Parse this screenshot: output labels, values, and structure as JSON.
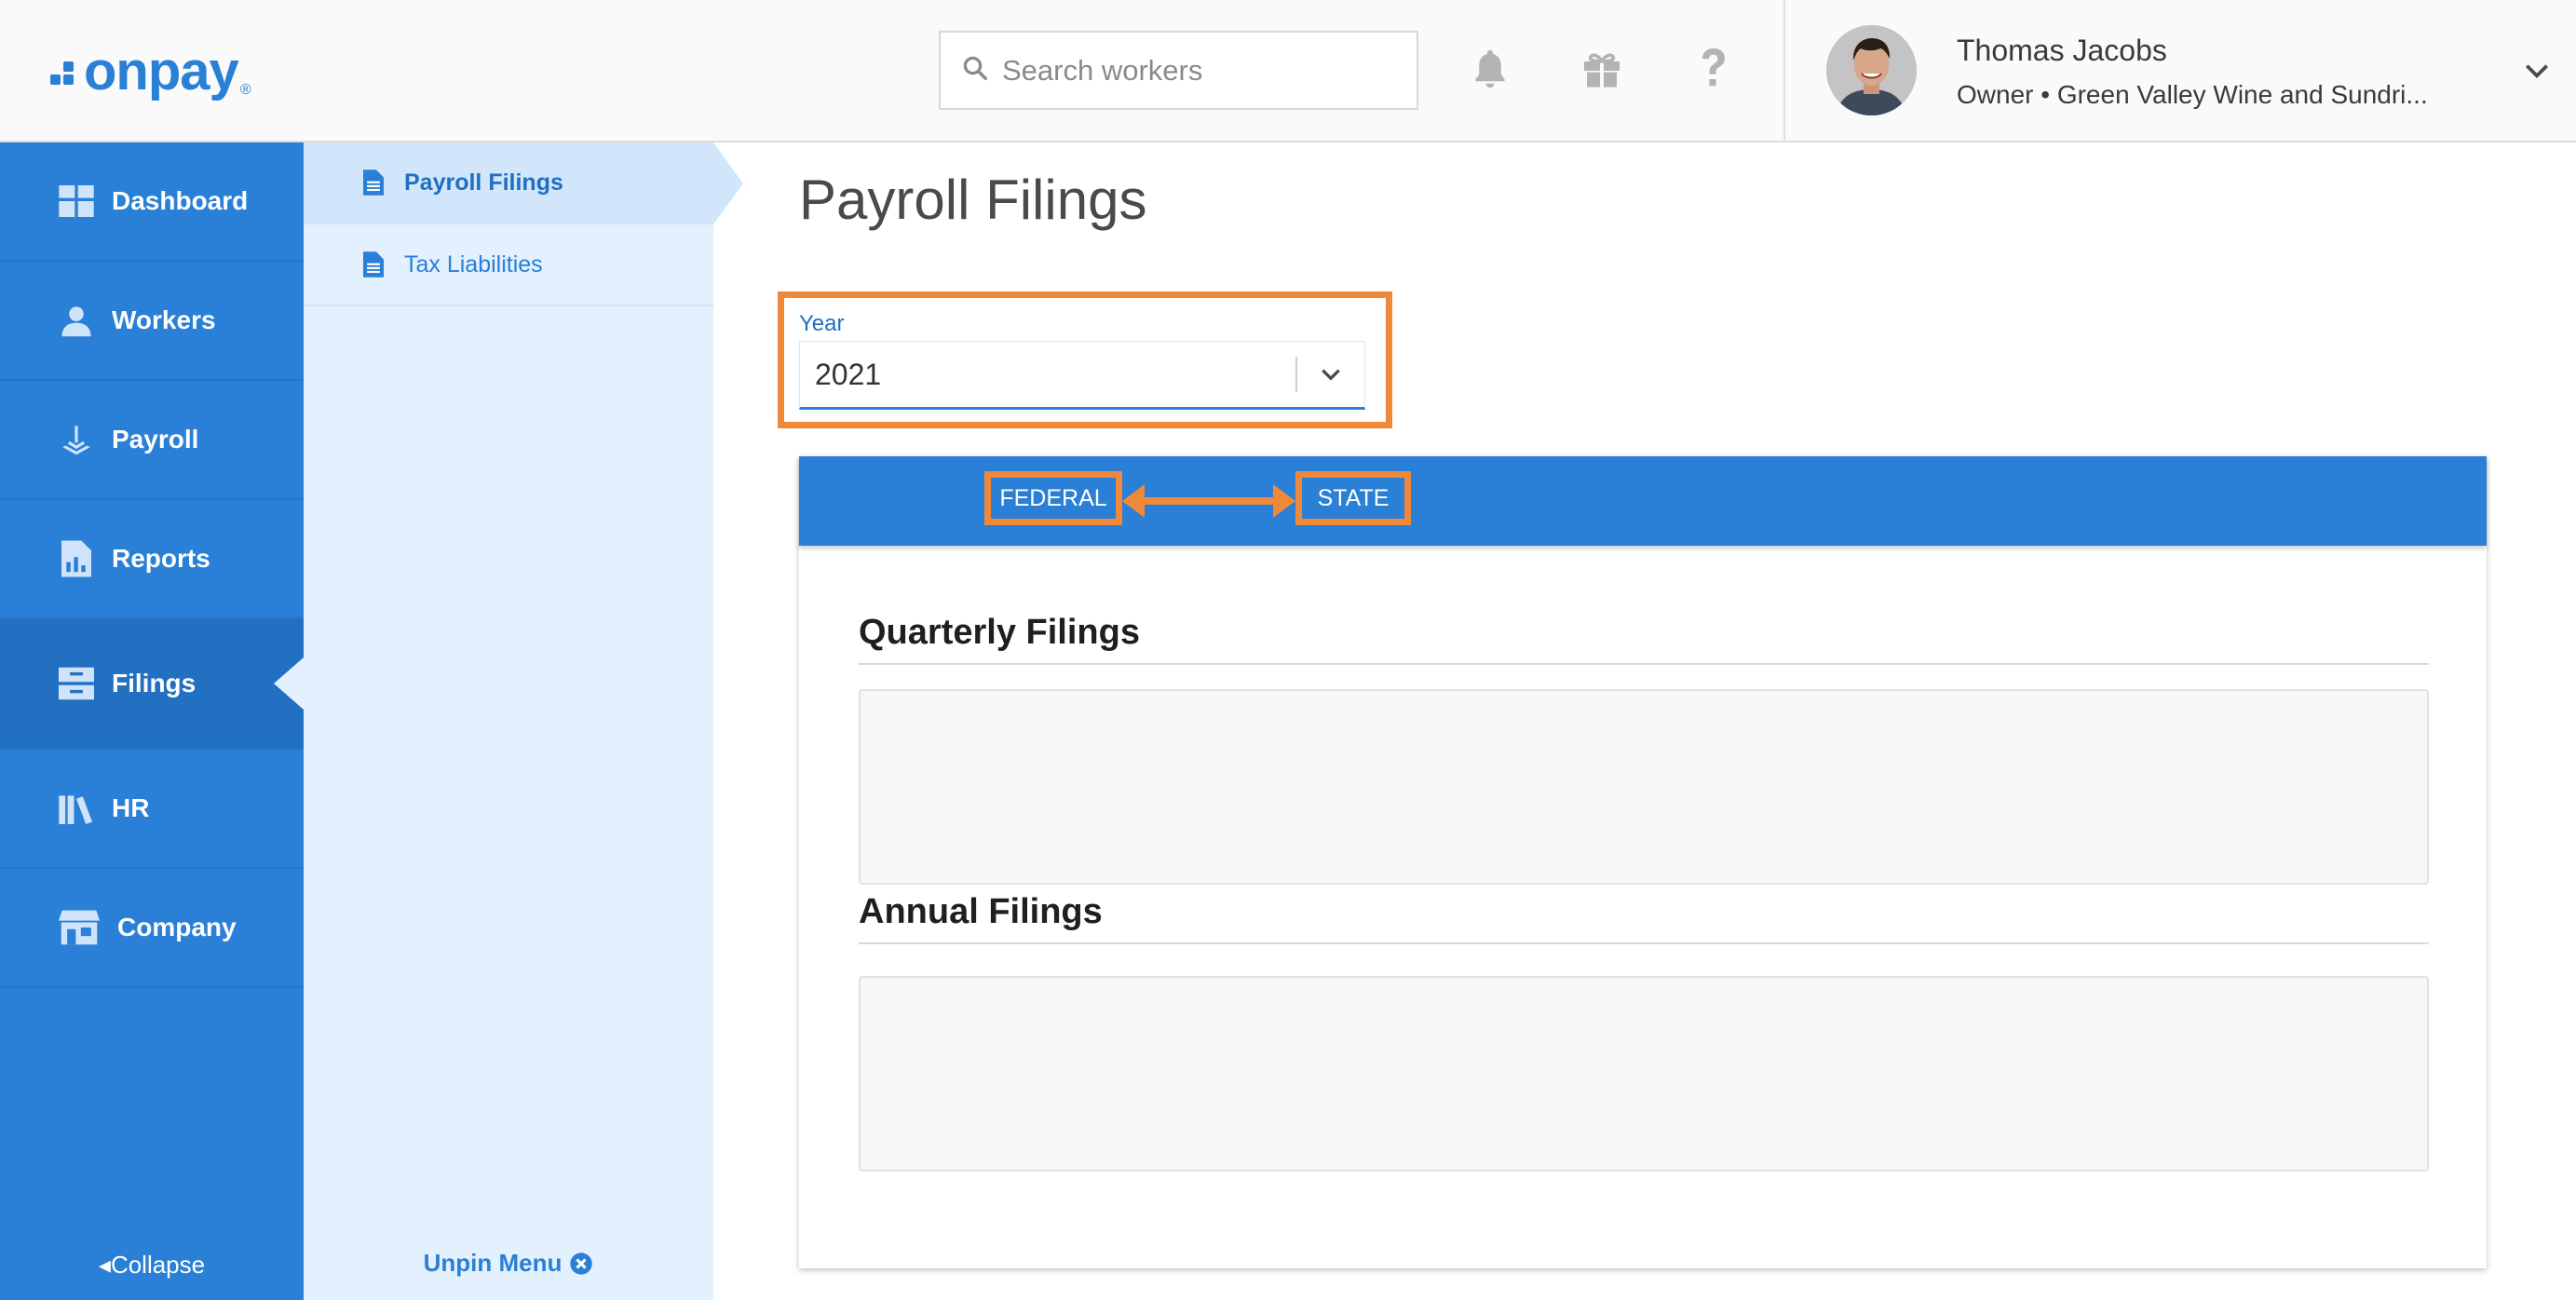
{
  "brand": {
    "name": "onpay",
    "registered": "®",
    "color": "#2a7fd6"
  },
  "header": {
    "search_placeholder": "Search workers",
    "icons": [
      "bell-icon",
      "gift-icon",
      "question-icon"
    ],
    "user": {
      "name": "Thomas Jacobs",
      "role": "Owner • Green Valley Wine and Sundri..."
    }
  },
  "sidebar": {
    "items": [
      {
        "label": "Dashboard",
        "icon": "dashboard-icon"
      },
      {
        "label": "Workers",
        "icon": "workers-icon"
      },
      {
        "label": "Payroll",
        "icon": "payroll-icon"
      },
      {
        "label": "Reports",
        "icon": "reports-icon"
      },
      {
        "label": "Filings",
        "icon": "filings-icon",
        "active": true
      },
      {
        "label": "HR",
        "icon": "hr-icon"
      },
      {
        "label": "Company",
        "icon": "company-icon"
      }
    ],
    "collapse_label": "Collapse"
  },
  "subnav": {
    "items": [
      {
        "label": "Payroll Filings",
        "active": true
      },
      {
        "label": "Tax Liabilities"
      }
    ],
    "unpin_label": "Unpin Menu"
  },
  "main": {
    "title": "Payroll Filings",
    "year": {
      "label": "Year",
      "value": "2021"
    },
    "tabs": [
      {
        "label": "FEDERAL"
      },
      {
        "label": "STATE"
      }
    ],
    "sections": [
      {
        "title": "Quarterly Filings"
      },
      {
        "title": "Annual Filings"
      }
    ]
  },
  "colors": {
    "primary": "#2a7fd6",
    "highlight": "#f0883a",
    "subnav_bg": "#e3f0fd"
  }
}
